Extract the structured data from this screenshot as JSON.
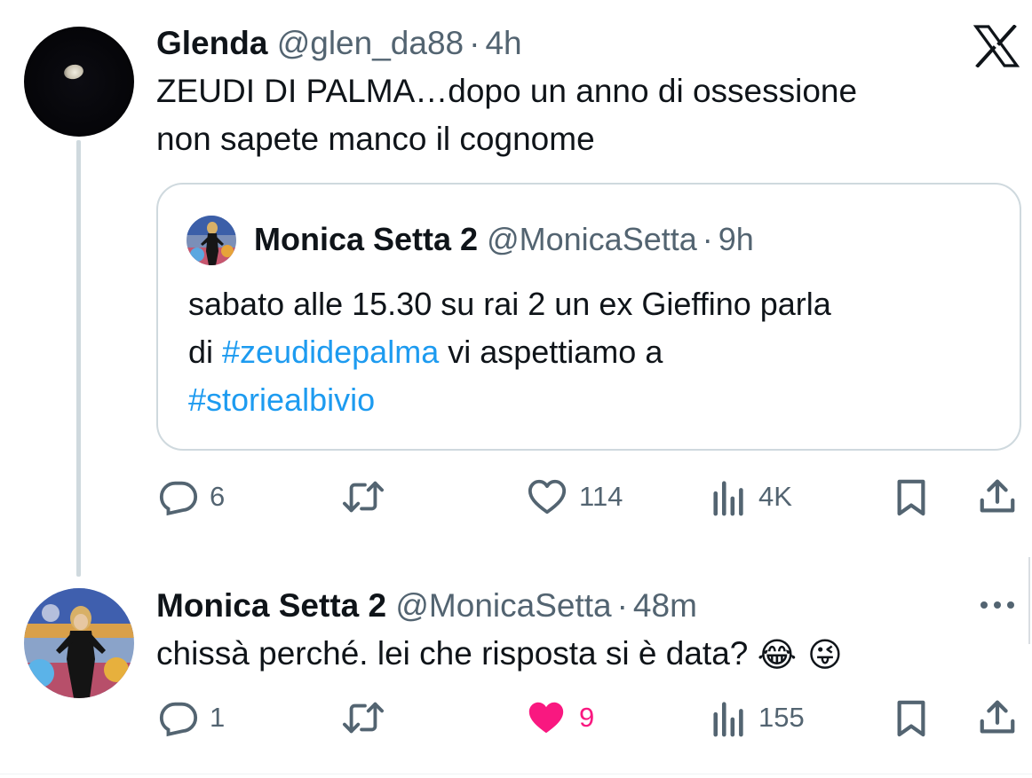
{
  "tweet": {
    "author_name": "Glenda",
    "author_handle": "@glen_da88",
    "separator": "·",
    "time": "4h",
    "text_lines": [
      "ZEUDI DI PALMA…dopo un anno di ossessione",
      "non sapete manco il cognome"
    ],
    "quoted": {
      "author_name": "Monica Setta 2",
      "author_handle": "@MonicaSetta",
      "separator": "·",
      "time": "9h",
      "line1": "sabato alle 15.30 su rai 2 un ex Gieffino parla",
      "line2_prefix": "di ",
      "hashtag1": "#zeudidepalma",
      "line2_suffix": " vi aspettiamo a",
      "hashtag2": "#storiealbivio"
    },
    "actions": {
      "replies": "6",
      "reposts": "",
      "likes": "114",
      "views": "4K"
    }
  },
  "reply": {
    "author_name": "Monica Setta 2",
    "author_handle": "@MonicaSetta",
    "separator": "·",
    "time": "48m",
    "text": "chissà perché. lei che risposta si è data?",
    "emojis": "😂 😜",
    "actions": {
      "replies": "1",
      "reposts": "",
      "likes": "9",
      "views": "155"
    }
  },
  "icons": {
    "brand": "x-logo",
    "reply": "reply-icon",
    "repost": "repost-icon",
    "like": "heart-icon",
    "views": "views-icon",
    "bookmark": "bookmark-icon",
    "share": "share-icon",
    "more": "more-icon"
  },
  "colors": {
    "text": "#0f1419",
    "secondary": "#536471",
    "link": "#1d9bf0",
    "like_active": "#f91880",
    "border": "#cfd9de"
  }
}
